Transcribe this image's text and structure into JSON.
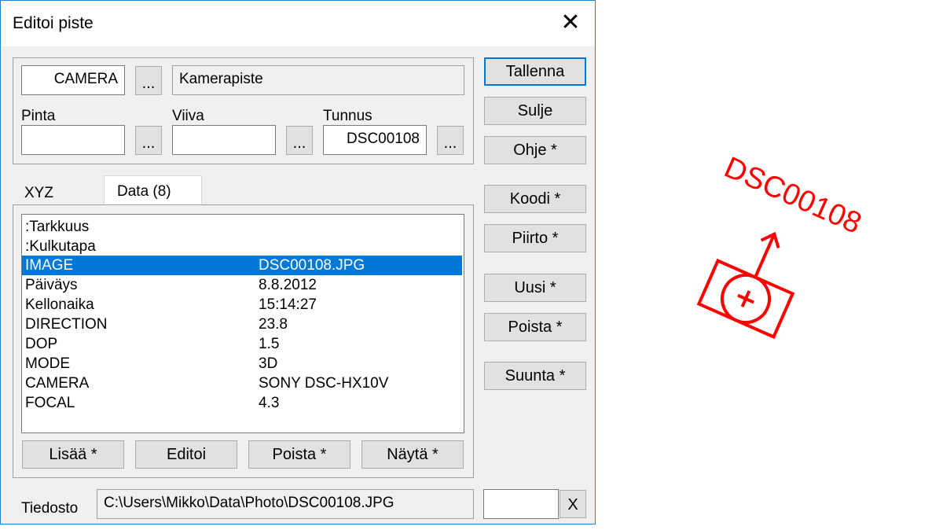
{
  "dialog": {
    "title": "Editoi piste",
    "close_glyph": "✕"
  },
  "header": {
    "code_value": "CAMERA",
    "code_browse": "...",
    "code_description": "Kamerapiste",
    "pinta_label": "Pinta",
    "pinta_value": "",
    "pinta_browse": "...",
    "viiva_label": "Viiva",
    "viiva_value": "",
    "viiva_browse": "...",
    "tunnus_label": "Tunnus",
    "tunnus_value": "DSC00108",
    "tunnus_browse": "..."
  },
  "tabs": [
    {
      "label": "XYZ",
      "active": false
    },
    {
      "label": "Data (8)",
      "active": true
    }
  ],
  "data_list": {
    "rows": [
      {
        "key": ":Tarkkuus",
        "value": ""
      },
      {
        "key": ":Kulkutapa",
        "value": ""
      },
      {
        "key": "IMAGE",
        "value": "DSC00108.JPG",
        "selected": true
      },
      {
        "key": "Päiväys",
        "value": "8.8.2012"
      },
      {
        "key": "Kellonaika",
        "value": "15:14:27"
      },
      {
        "key": "DIRECTION",
        "value": "23.8"
      },
      {
        "key": "DOP",
        "value": "1.5"
      },
      {
        "key": "MODE",
        "value": "3D"
      },
      {
        "key": "CAMERA",
        "value": "SONY DSC-HX10V"
      },
      {
        "key": "FOCAL",
        "value": "4.3"
      }
    ],
    "selection_color": "#0078d7"
  },
  "list_buttons": {
    "add": "Lisää *",
    "edit": "Editoi",
    "delete": "Poista *",
    "show": "Näytä *"
  },
  "side_buttons": {
    "save": "Tallenna",
    "close": "Sulje",
    "help": "Ohje *",
    "code": "Koodi *",
    "draw": "Piirto *",
    "new": "Uusi *",
    "delete": "Poista *",
    "direction": "Suunta *"
  },
  "file": {
    "label": "Tiedosto",
    "path": "C:\\Users\\Mikko\\Data\\Photo\\DSC00108.JPG",
    "extra_value": "",
    "clear_button": "X"
  },
  "preview": {
    "point_label": "DSC00108",
    "symbol_icon": "camera-point-symbol",
    "color": "#ff0000",
    "direction_deg": 23.8
  }
}
